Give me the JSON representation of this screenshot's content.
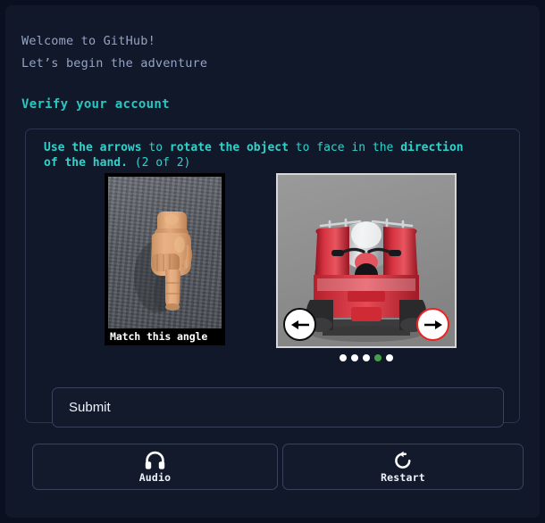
{
  "greeting": {
    "line1": "Welcome to GitHub!",
    "line2": "Let’s begin the adventure"
  },
  "verify": {
    "heading": "Verify your account",
    "instruction": {
      "bold1": "Use the arrows",
      "reg1": " to ",
      "bold2": "rotate the object",
      "reg2": " to face in the ",
      "bold3": "direction of the hand.",
      "reg3": " (2 of 2)",
      "full_text": "Use the arrows to rotate the object to face in the direction of the hand. (2 of 2)"
    },
    "hand_panel": {
      "caption": "Match this angle",
      "icon": "pointing-hand-down-image"
    },
    "object_panel": {
      "icon": "red-atv-quad-bike-image",
      "left_arrow_label": "←",
      "right_arrow_label": "→"
    },
    "dots": {
      "count": 5,
      "active_index": 3,
      "active_color": "#43a047",
      "inactive_color": "#ffffff"
    }
  },
  "submit": {
    "label": "Submit"
  },
  "footer": {
    "audio": {
      "label": "Audio",
      "icon": "headphones-icon"
    },
    "restart": {
      "label": "Restart",
      "icon": "restart-icon"
    }
  },
  "colors": {
    "page_bg": "#0b1020",
    "panel_bg": "#111829",
    "accent_teal": "#2fd3cc",
    "text_muted": "#95a3c4",
    "border": "#39425e",
    "arrow_active": "#ee2222"
  }
}
